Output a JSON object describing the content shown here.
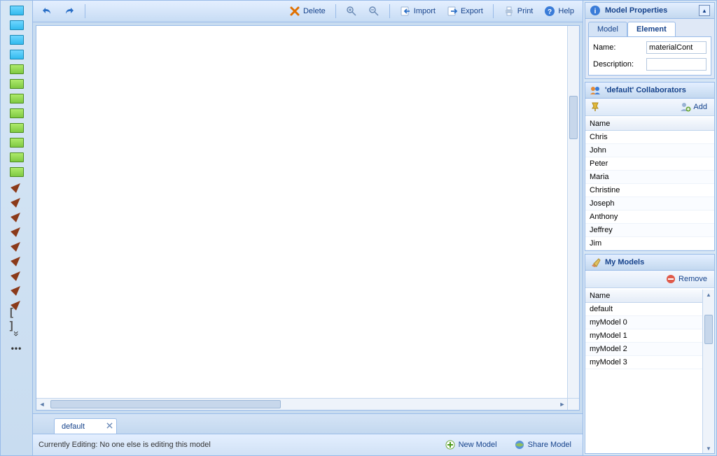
{
  "toolbar": {
    "delete": "Delete",
    "import": "Import",
    "export": "Export",
    "print": "Print",
    "help": "Help"
  },
  "tabs": {
    "current": "default"
  },
  "status": {
    "editing": "Currently Editing: No one else is editing this model",
    "new_model": "New Model",
    "share_model": "Share Model"
  },
  "properties": {
    "panel_title": "Model Properties",
    "tab_model": "Model",
    "tab_element": "Element",
    "name_label": "Name:",
    "name_value": "materialCont",
    "desc_label": "Description:",
    "desc_value": ""
  },
  "collab": {
    "panel_title": "'default' Collaborators",
    "add_label": "Add",
    "column": "Name",
    "rows": [
      "Chris",
      "John",
      "Peter",
      "Maria",
      "Christine",
      "Joseph",
      "Anthony",
      "Jeffrey",
      "Jim"
    ]
  },
  "models": {
    "panel_title": "My Models",
    "remove_label": "Remove",
    "column": "Name",
    "rows": [
      "default",
      "myModel 0",
      "myModel 1",
      "myModel 2",
      "myModel 3"
    ]
  }
}
